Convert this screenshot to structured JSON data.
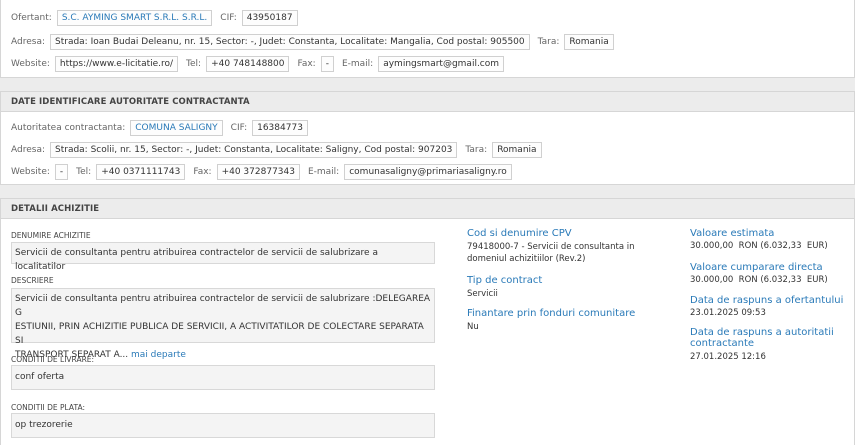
{
  "ofertant": {
    "ofertant_label": "Ofertant:",
    "ofertant_value": "S.C. AYMING SMART S.R.L. S.R.L.",
    "cif_label": "CIF:",
    "cif_value": "43950187",
    "adresa_label": "Adresa:",
    "adresa_value": "Strada: Ioan Budai Deleanu, nr. 15, Sector: -, Judet: Constanta, Localitate: Mangalia, Cod postal: 905500",
    "tara_label": "Tara:",
    "tara_value": "Romania",
    "website_label": "Website:",
    "website_value": "https://www.e-licitatie.ro/",
    "tel_label": "Tel:",
    "tel_value": "+40 748148800",
    "fax_label": "Fax:",
    "fax_value": "-",
    "email_label": "E-mail:",
    "email_value": "aymingsmart@gmail.com"
  },
  "autoritate": {
    "header": "DATE IDENTIFICARE AUTORITATE CONTRACTANTA",
    "autoritate_label": "Autoritatea contractanta:",
    "autoritate_value": "COMUNA SALIGNY",
    "cif_label": "CIF:",
    "cif_value": "16384773",
    "adresa_label": "Adresa:",
    "adresa_value": "Strada: Scolii, nr. 15, Sector: -, Judet: Constanta, Localitate: Saligny, Cod postal: 907203",
    "tara_label": "Tara:",
    "tara_value": "Romania",
    "website_label": "Website:",
    "website_value": "-",
    "tel_label": "Tel:",
    "tel_value": "+40 0371111743",
    "fax_label": "Fax:",
    "fax_value": "+40 372877343",
    "email_label": "E-mail:",
    "email_value": "comunasaligny@primariasaligny.ro"
  },
  "achizitie": {
    "header": "DETALII ACHIZITIE",
    "denumire_label": "DENUMIRE ACHIZITIE",
    "denumire_value": "Servicii de consultanta pentru atribuirea contractelor de servicii de salubrizare a localitatilor",
    "descriere_label": "DESCRIERE",
    "descriere_line1": "Servicii de consultanta pentru atribuirea contractelor de servicii de salubrizare :DELEGAREA G",
    "descriere_line2": "ESTIUNII, PRIN ACHIZITIE PUBLICA DE SERVICII, A ACTIVITATILOR DE COLECTARE SEPARATA SI",
    "descriere_line3": "TRANSPORT SEPARAT A...",
    "mai_departe": "mai departe",
    "livrare_label": "CONDITII DE LIVRARE:",
    "livrare_value": "conf oferta",
    "plata_label": "CONDITII DE PLATA:",
    "plata_value": "op trezorerie",
    "cpv_head": "Cod si denumire CPV",
    "cpv_line1": "79418000-7 - Servicii de consultanta in",
    "cpv_line2": "domeniul achizitiilor (Rev.2)",
    "tip_head": "Tip de contract",
    "tip_value": "Servicii",
    "fonduri_head": "Finantare prin fonduri comunitare",
    "fonduri_value": "Nu",
    "valoare_est_head": "Valoare estimata",
    "valoare_est_value": "30.000,00  RON (6.032,33  EUR)",
    "valoare_cump_head": "Valoare cumparare directa",
    "valoare_cump_value": "30.000,00  RON (6.032,33  EUR)",
    "raspuns_of_head": "Data de raspuns a ofertantului",
    "raspuns_of_value": "23.01.2025 09:53",
    "raspuns_aut_head1": "Data de raspuns a autoritatii",
    "raspuns_aut_head2": "contractante",
    "raspuns_aut_value": "27.01.2025 12:16"
  }
}
